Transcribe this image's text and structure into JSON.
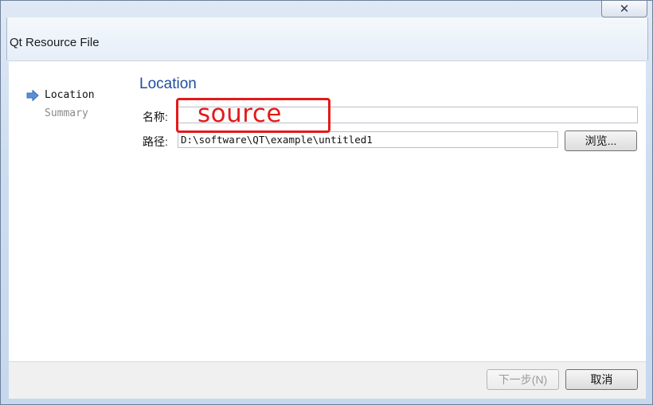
{
  "window": {
    "title": "Qt Resource File",
    "close_glyph": "✕"
  },
  "sidebar": {
    "items": [
      {
        "label": "Location",
        "active": true,
        "icon": "arrow-right-icon"
      },
      {
        "label": "Summary",
        "active": false
      }
    ]
  },
  "page": {
    "heading": "Location",
    "name_label": "名称:",
    "name_value": "",
    "path_label": "路径:",
    "path_value": "D:\\software\\QT\\example\\untitled1",
    "browse_label": "浏览..."
  },
  "annotation": {
    "text": "source",
    "color": "#e31a1a"
  },
  "footer": {
    "next_label": "下一步(N)",
    "next_enabled": false,
    "cancel_label": "取消"
  },
  "colors": {
    "heading": "#1f4f9c",
    "title_bar": "#cdddf0"
  }
}
